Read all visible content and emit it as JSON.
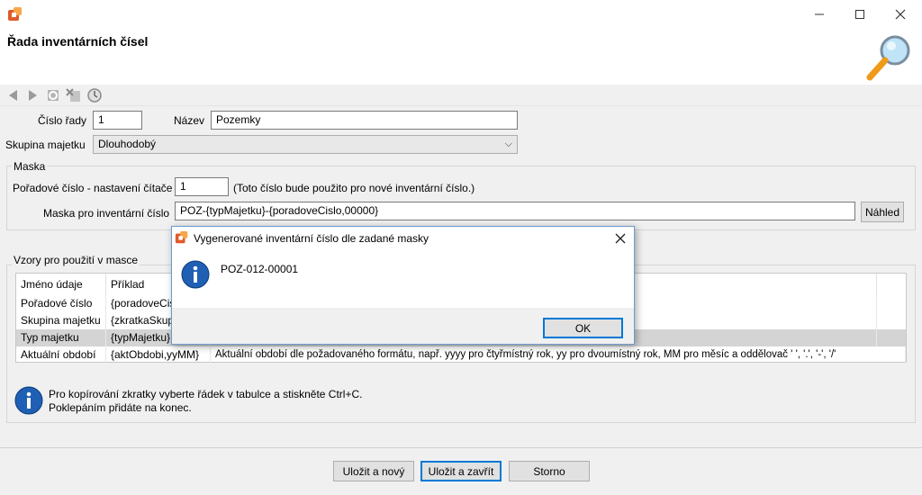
{
  "window": {
    "title": "Řada inventárních čísel",
    "min_icon": "minimize-icon",
    "max_icon": "maximize-icon",
    "close_icon": "close-icon"
  },
  "toolbar": {
    "icons": [
      "back-arrow-icon",
      "forward-arrow-icon",
      "refresh-icon",
      "delete-icon",
      "history-icon"
    ]
  },
  "form": {
    "cislo_rady_label": "Číslo řady",
    "cislo_rady_value": "1",
    "nazev_label": "Název",
    "nazev_value": "Pozemky",
    "skupina_label": "Skupina majetku",
    "skupina_value": "Dlouhodobý"
  },
  "maska": {
    "group_label": "Maska",
    "poradove_label": "Pořadové číslo - nastavení čítače",
    "poradove_value": "1",
    "poradove_note": "(Toto číslo bude použito pro nové inventární číslo.)",
    "maska_label": "Maska pro inventární číslo",
    "maska_value": "POZ-{typMajetku}-{poradoveCislo,00000}",
    "nahled_button": "Náhled"
  },
  "vzory": {
    "group_label": "Vzory pro použití v masce",
    "columns": [
      "Jméno údaje",
      "Příklad",
      ""
    ],
    "rows": [
      {
        "name": "Pořadové číslo",
        "example": "{poradoveCis",
        "desc": ""
      },
      {
        "name": "Skupina majetku",
        "example": "{zkratkaSkup",
        "desc": ""
      },
      {
        "name": "Typ majetku",
        "example": "{typMajetku}",
        "desc": ""
      },
      {
        "name": "Aktuální období",
        "example": "{aktObdobi,yyMM}",
        "desc": "Aktuální období dle požadovaného formátu, např. yyyy pro čtyřmístný rok, yy pro dvoumístný rok, MM pro měsíc a oddělovač ' ', '.', '-', '/'"
      }
    ],
    "info_line1": "Pro kopírování zkratky vyberte řádek v tabulce a stiskněte Ctrl+C.",
    "info_line2": "Poklepáním přidáte na konec."
  },
  "buttons": {
    "save_new": "Uložit a nový",
    "save_close": "Uložit a zavřít",
    "cancel": "Storno"
  },
  "msgbox": {
    "title": "Vygenerované inventární číslo dle zadané masky",
    "message": "POZ-012-00001",
    "ok": "OK"
  },
  "colors": {
    "accent": "#0078d7",
    "info_blue": "#1f5fb4"
  }
}
